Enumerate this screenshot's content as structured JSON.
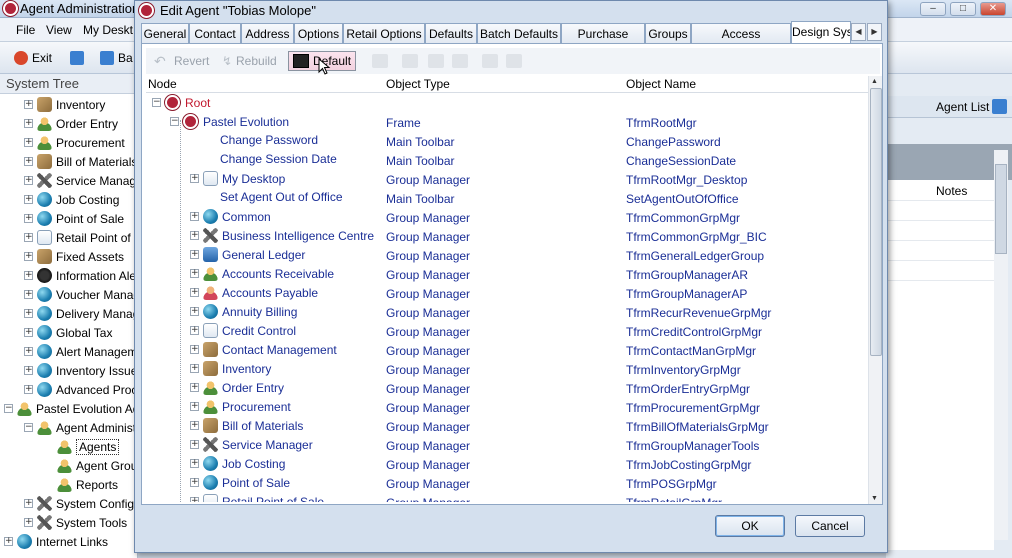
{
  "background_window": {
    "title": "Agent Administration",
    "menu": [
      "File",
      "View",
      "My Deskt"
    ],
    "toolbar": [
      "Exit",
      "Ba"
    ],
    "system_tree_label": "System Tree",
    "agent_list_label": "Agent List",
    "notes_header": "Notes"
  },
  "system_tree": [
    {
      "label": "Inventory",
      "icon": "box-icon",
      "level": 1
    },
    {
      "label": "Order Entry",
      "icon": "people-icon",
      "level": 1
    },
    {
      "label": "Procurement",
      "icon": "people-icon",
      "level": 1
    },
    {
      "label": "Bill of Materials",
      "icon": "box-icon",
      "level": 1
    },
    {
      "label": "Service Manage",
      "icon": "tools-icon",
      "level": 1
    },
    {
      "label": "Job Costing",
      "icon": "globe-icon",
      "level": 1
    },
    {
      "label": "Point of Sale",
      "icon": "globe-icon",
      "level": 1
    },
    {
      "label": "Retail Point of S",
      "icon": "doc-icon",
      "level": 1
    },
    {
      "label": "Fixed Assets",
      "icon": "box-icon",
      "level": 1
    },
    {
      "label": "Information Ale",
      "icon": "dark-icon",
      "level": 1
    },
    {
      "label": "Voucher Manag",
      "icon": "globe-icon",
      "level": 1
    },
    {
      "label": "Delivery Manag",
      "icon": "globe-icon",
      "level": 1
    },
    {
      "label": "Global Tax",
      "icon": "globe-icon",
      "level": 1
    },
    {
      "label": "Alert Manageme",
      "icon": "globe-icon",
      "level": 1
    },
    {
      "label": "Inventory Issue",
      "icon": "globe-icon",
      "level": 1
    },
    {
      "label": "Advanced Proc",
      "icon": "globe-icon",
      "level": 1
    },
    {
      "label": "Pastel Evolution Ad",
      "icon": "people-icon",
      "level": 0
    },
    {
      "label": "Agent Administ",
      "icon": "people-icon",
      "level": 1
    },
    {
      "label": "Agents",
      "icon": "people-icon",
      "level": 2,
      "selected": true
    },
    {
      "label": "Agent Grou",
      "icon": "people-icon",
      "level": 2
    },
    {
      "label": "Reports",
      "icon": "people-icon",
      "level": 2
    },
    {
      "label": "System Configu",
      "icon": "tools-icon",
      "level": 1
    },
    {
      "label": "System Tools",
      "icon": "tools-icon",
      "level": 1
    },
    {
      "label": "Internet Links",
      "icon": "globe-icon",
      "level": 0
    }
  ],
  "dialog": {
    "title": "Edit Agent \"Tobias Molope\"",
    "tabs": [
      "General",
      "Contact",
      "Address",
      "Options",
      "Retail Options",
      "Defaults",
      "Batch Defaults",
      "Purchase Order",
      "Groups",
      "Access Permissions",
      "Design Sys"
    ],
    "active_tab": "Design Sys",
    "toolbar": {
      "revert": "Revert",
      "rebuild": "Rebuild",
      "default": "Default"
    },
    "columns": {
      "node": "Node",
      "type": "Object Type",
      "name": "Object Name"
    },
    "ok": "OK",
    "cancel": "Cancel"
  },
  "design_rows": [
    {
      "node": "Root",
      "type": "",
      "name": "",
      "level": 0,
      "expander": "minus",
      "icon": "pastel-logo"
    },
    {
      "node": "Pastel Evolution",
      "type": "Frame",
      "name": "TfrmRootMgr",
      "level": 1,
      "expander": "minus",
      "icon": "pastel-logo"
    },
    {
      "node": "Change Password",
      "type": "Main Toolbar",
      "name": "ChangePassword",
      "level": 2,
      "expander": "",
      "icon": ""
    },
    {
      "node": "Change Session Date",
      "type": "Main Toolbar",
      "name": "ChangeSessionDate",
      "level": 2,
      "expander": "",
      "icon": ""
    },
    {
      "node": "My Desktop",
      "type": "Group Manager",
      "name": "TfrmRootMgr_Desktop",
      "level": 2,
      "expander": "plus",
      "icon": "doc-icon"
    },
    {
      "node": "Set Agent Out of Office",
      "type": "Main Toolbar",
      "name": "SetAgentOutOfOffice",
      "level": 2,
      "expander": "",
      "icon": ""
    },
    {
      "node": "Common",
      "type": "Group Manager",
      "name": "TfrmCommonGrpMgr",
      "level": 2,
      "expander": "plus",
      "icon": "globe-icon"
    },
    {
      "node": "Business Intelligence Centre",
      "type": "Group Manager",
      "name": "TfrmCommonGrpMgr_BIC",
      "level": 2,
      "expander": "plus",
      "icon": "tools-icon"
    },
    {
      "node": "General Ledger",
      "type": "Group Manager",
      "name": "TfrmGeneralLedgerGroup",
      "level": 2,
      "expander": "plus",
      "icon": "blue-icon"
    },
    {
      "node": "Accounts Receivable",
      "type": "Group Manager",
      "name": "TfrmGroupManagerAR",
      "level": 2,
      "expander": "plus",
      "icon": "people-icon"
    },
    {
      "node": "Accounts Payable",
      "type": "Group Manager",
      "name": "TfrmGroupManagerAP",
      "level": 2,
      "expander": "plus",
      "icon": "pink-icon"
    },
    {
      "node": "Annuity Billing",
      "type": "Group Manager",
      "name": "TfrmRecurRevenueGrpMgr",
      "level": 2,
      "expander": "plus",
      "icon": "globe-icon"
    },
    {
      "node": "Credit Control",
      "type": "Group Manager",
      "name": "TfrmCreditControlGrpMgr",
      "level": 2,
      "expander": "plus",
      "icon": "doc-icon"
    },
    {
      "node": "Contact Management",
      "type": "Group Manager",
      "name": "TfrmContactManGrpMgr",
      "level": 2,
      "expander": "plus",
      "icon": "box-icon"
    },
    {
      "node": "Inventory",
      "type": "Group Manager",
      "name": "TfrmInventoryGrpMgr",
      "level": 2,
      "expander": "plus",
      "icon": "box-icon"
    },
    {
      "node": "Order Entry",
      "type": "Group Manager",
      "name": "TfrmOrderEntryGrpMgr",
      "level": 2,
      "expander": "plus",
      "icon": "people-icon"
    },
    {
      "node": "Procurement",
      "type": "Group Manager",
      "name": "TfrmProcurementGrpMgr",
      "level": 2,
      "expander": "plus",
      "icon": "people-icon"
    },
    {
      "node": "Bill of Materials",
      "type": "Group Manager",
      "name": "TfrmBillOfMaterialsGrpMgr",
      "level": 2,
      "expander": "plus",
      "icon": "box-icon"
    },
    {
      "node": "Service Manager",
      "type": "Group Manager",
      "name": "TfrmGroupManagerTools",
      "level": 2,
      "expander": "plus",
      "icon": "tools-icon"
    },
    {
      "node": "Job Costing",
      "type": "Group Manager",
      "name": "TfrmJobCostingGrpMgr",
      "level": 2,
      "expander": "plus",
      "icon": "globe-icon"
    },
    {
      "node": "Point of Sale",
      "type": "Group Manager",
      "name": "TfrmPOSGrpMgr",
      "level": 2,
      "expander": "plus",
      "icon": "globe-icon"
    },
    {
      "node": "Retail Point of Sale",
      "type": "Group Manager",
      "name": "TfrmRetailGrpMgr",
      "level": 2,
      "expander": "plus",
      "icon": "doc-icon"
    }
  ]
}
